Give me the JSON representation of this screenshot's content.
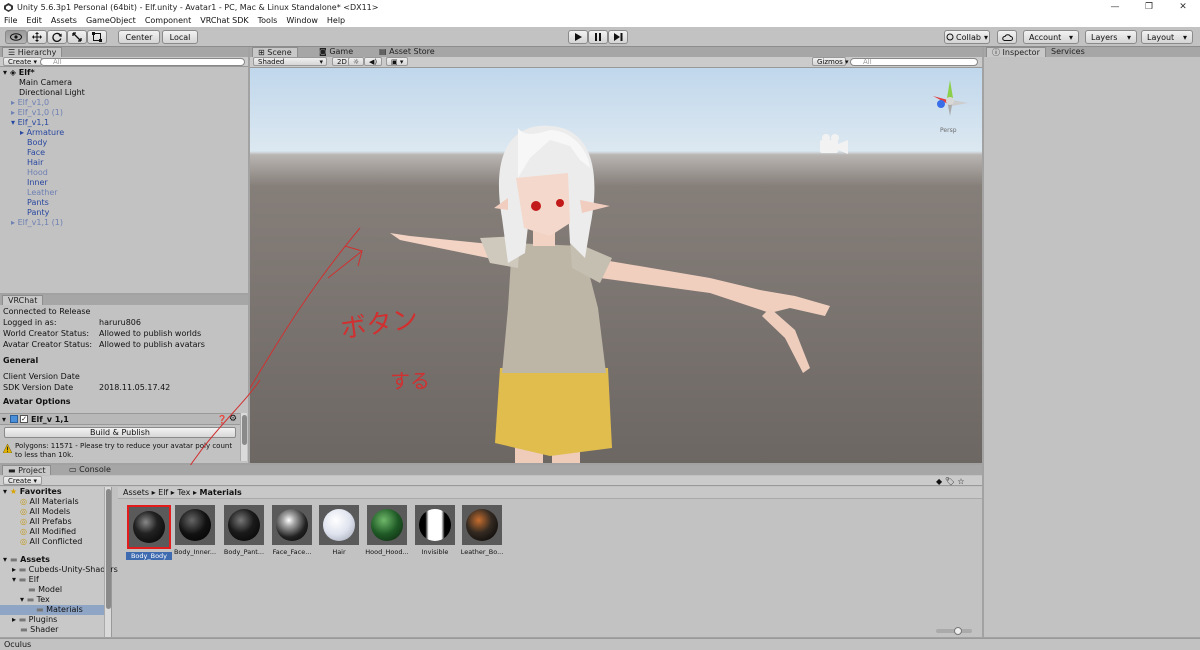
{
  "window": {
    "title": "Unity 5.6.3p1 Personal (64bit) - Elf.unity - Avatar1 - PC, Mac & Linux Standalone* <DX11>",
    "controls": [
      "—",
      "❐",
      "✕"
    ]
  },
  "menu": [
    "File",
    "Edit",
    "Assets",
    "GameObject",
    "Component",
    "VRChat SDK",
    "Tools",
    "Window",
    "Help"
  ],
  "toolbar": {
    "pivot": "Center",
    "space": "Local",
    "collab": "Collab",
    "account": "Account",
    "layers": "Layers",
    "layout": "Layout"
  },
  "hierarchy": {
    "tab": "Hierarchy",
    "create": "Create",
    "search_placeholder": "All",
    "scene": "Elf*",
    "items": [
      "Main Camera",
      "Directional Light",
      "Elf_v1,0",
      "Elf_v1,0 (1)",
      "Elf_v1,1",
      "Armature",
      "Body",
      "Face",
      "Hair",
      "Hood",
      "Inner",
      "Leather",
      "Pants",
      "Panty",
      "Elf_v1,1 (1)"
    ]
  },
  "vrchat": {
    "tab": "VRChat",
    "status": "Connected to Release",
    "logged_label": "Logged in as:",
    "logged_value": "haruru806",
    "world_label": "World Creator Status:",
    "world_value": "Allowed to publish worlds",
    "avatar_label": "Avatar Creator Status:",
    "avatar_value": "Allowed to publish avatars",
    "general": "General",
    "client_label": "Client Version Date",
    "sdk_label": "SDK Version Date",
    "sdk_value": "2018.11.05.17.42",
    "avatar_options": "Avatar Options",
    "avatar_name": "Elf_v 1,1",
    "build_button": "Build & Publish",
    "warning": "Polygons: 11571 - Please try to reduce your avatar poly count to less than 10k."
  },
  "scene": {
    "tabs": [
      "Scene",
      "Game",
      "Asset Store"
    ],
    "shading": "Shaded",
    "mode_2d": "2D",
    "gizmos": "Gizmos",
    "search_placeholder": "All",
    "persp": "Persp",
    "annotation": "ボタン",
    "annotation2": "する"
  },
  "inspector": {
    "tabs": [
      "Inspector",
      "Services"
    ]
  },
  "project": {
    "tabs": [
      "Project",
      "Console"
    ],
    "create": "Create",
    "favorites_header": "Favorites",
    "favorites": [
      "All Materials",
      "All Models",
      "All Prefabs",
      "All Modified",
      "All Conflicted"
    ],
    "assets_header": "Assets",
    "assets": [
      "Cubeds-Unity-Shaders",
      "Elf",
      "Model",
      "Tex",
      "Materials",
      "Plugins",
      "Shader"
    ],
    "breadcrumb": [
      "Assets",
      "Elf",
      "Tex",
      "Materials"
    ],
    "materials": [
      {
        "name": "Body_Body",
        "color": "#111111"
      },
      {
        "name": "Body_Inner...",
        "color": "#101010"
      },
      {
        "name": "Body_Pant...",
        "color": "#1a1a1a"
      },
      {
        "name": "Face_Face...",
        "color": "#222222"
      },
      {
        "name": "Hair",
        "color": "#dfe3ee"
      },
      {
        "name": "Hood_Hood...",
        "color": "#1f5a26"
      },
      {
        "name": "Invisible",
        "color": "#111111"
      },
      {
        "name": "Leather_Bo...",
        "color": "#332a22"
      }
    ]
  },
  "statusbar": "Oculus"
}
